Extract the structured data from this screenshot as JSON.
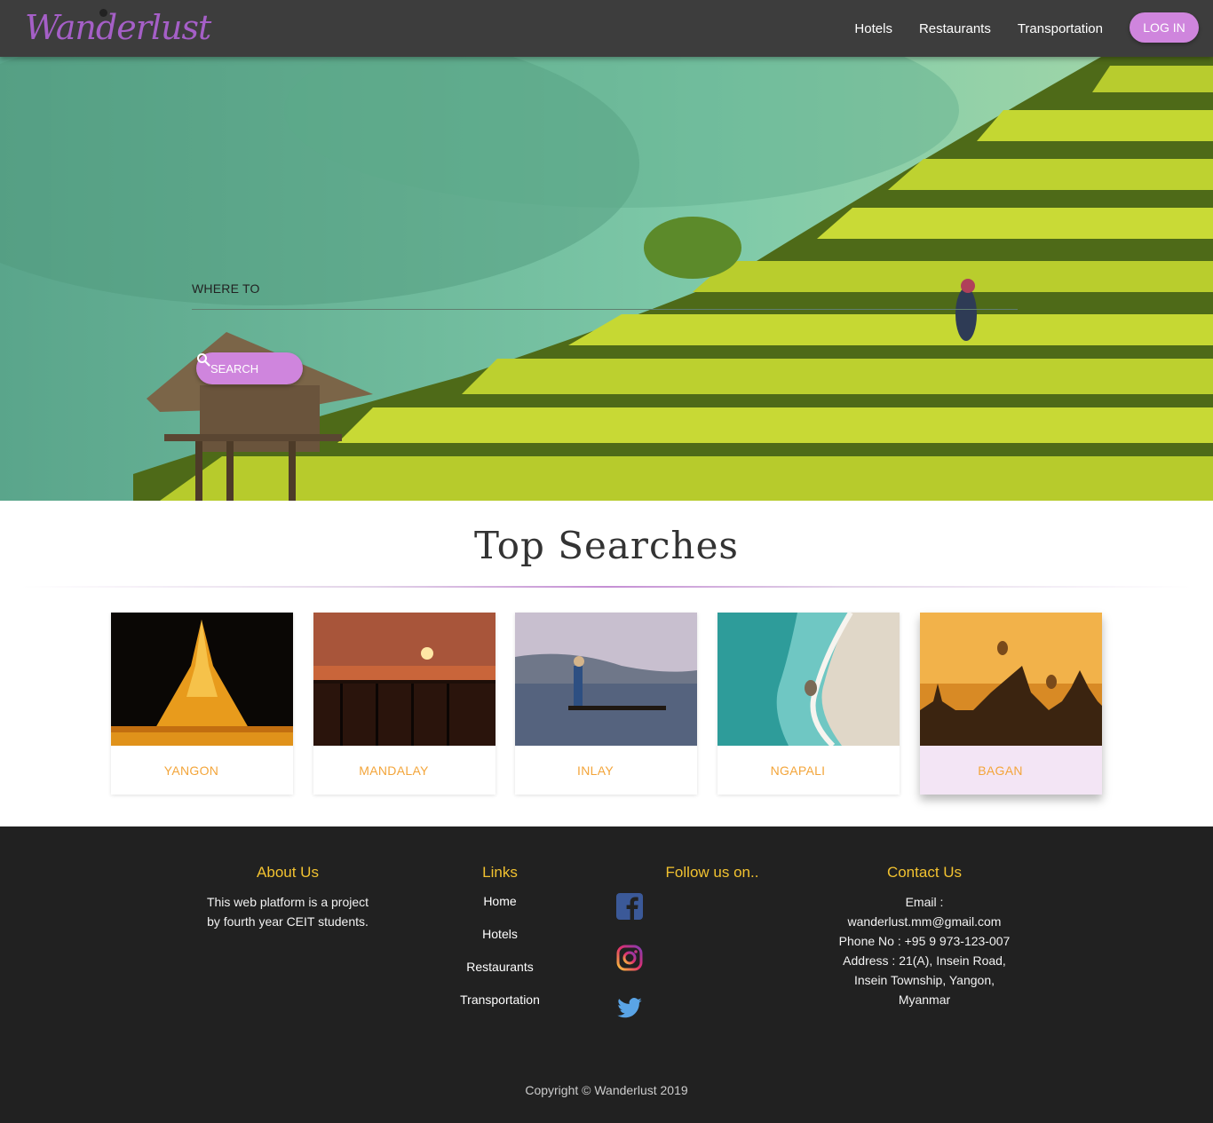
{
  "brand": {
    "logo_text": "Wanderlust",
    "accent_color": "#cf85dd"
  },
  "nav": {
    "items": [
      {
        "label": "Hotels"
      },
      {
        "label": "Restaurants"
      },
      {
        "label": "Transportation"
      }
    ],
    "login_label": "LOG IN"
  },
  "hero": {
    "where_label": "WHERE TO",
    "search_label": "SEARCH",
    "search_icon": "search-icon"
  },
  "top_searches": {
    "title": "Top Searches",
    "cards": [
      {
        "label": "YANGON"
      },
      {
        "label": "MANDALAY"
      },
      {
        "label": "INLAY"
      },
      {
        "label": "NGAPALI"
      },
      {
        "label": "BAGAN"
      }
    ],
    "label_color": "#f3a53a"
  },
  "footer": {
    "about": {
      "heading": "About Us",
      "text_line1": "This web platform is a project",
      "text_line2": "by fourth year CEIT students."
    },
    "links": {
      "heading": "Links",
      "items": [
        {
          "label": "Home"
        },
        {
          "label": "Hotels"
        },
        {
          "label": "Restaurants"
        },
        {
          "label": "Transportation"
        }
      ]
    },
    "follow": {
      "heading": "Follow us on..",
      "icons": [
        "facebook-icon",
        "instagram-icon",
        "twitter-icon"
      ]
    },
    "contact": {
      "heading": "Contact Us",
      "lines": [
        "Email :",
        "wanderlust.mm@gmail.com",
        "Phone No : +95 9 973-123-007",
        "Address : 21(A), Insein Road,",
        "Insein Township, Yangon,",
        "Myanmar"
      ]
    },
    "copyright": "Copyright © Wanderlust 2019",
    "heading_color": "#f2c230"
  }
}
